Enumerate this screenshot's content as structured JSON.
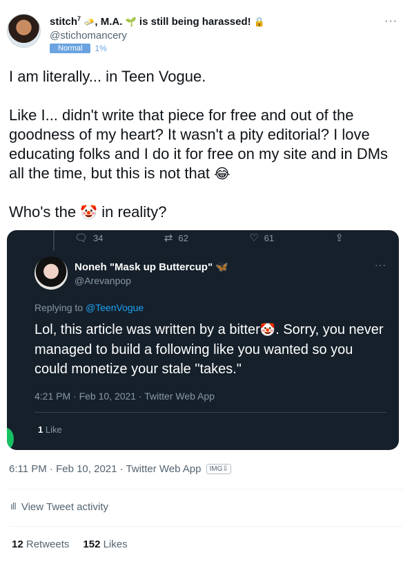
{
  "author": {
    "name_start": "stitch",
    "name_sup": "7",
    "name_emoji_1": "🧈",
    "name_degree": ", M.A.",
    "name_emoji_2": "🌱",
    "name_end": " is still being harassed!",
    "name_emoji_3": "🔒",
    "handle": "@stichomancery",
    "badge": "Normal",
    "badge_pct": "1%"
  },
  "more_icon": "···",
  "tweet": {
    "line1": "I am literally... in Teen Vogue.",
    "line2": "Like I... didn't write that piece for free and out of the goodness of my heart? It wasn't a pity editorial? I love educating folks and I do it for free on my site and in DMs all the time, but this is not that",
    "line2_emoji": "😂",
    "line3_start": "Who's the",
    "line3_emoji": "🤡",
    "line3_end": "in reality?"
  },
  "embed": {
    "actions": {
      "reply_icon": "reply-icon",
      "reply_count": "34",
      "retweet_count": "62",
      "like_count": "61"
    },
    "author_name": "Noneh \"Mask up Buttercup\"",
    "author_emoji": "🦋",
    "author_handle": "@Arevanpop",
    "replying_prefix": "Replying to",
    "replying_mention": "@TeenVogue",
    "text_start": "Lol, this article was written by a bitter",
    "text_emoji": "🤡",
    "text_end": ". Sorry, you never managed to build a following like you wanted so you could monetize your stale \"takes.\"",
    "meta": "4:21 PM · Feb 10, 2021 · Twitter Web App",
    "likes_count": "1",
    "likes_label": "Like"
  },
  "meta": {
    "timestamp": "6:11 PM · Feb 10, 2021 · Twitter Web App",
    "img_tag": "IMG⇩"
  },
  "activity": {
    "label": "View Tweet activity"
  },
  "stats": {
    "retweets_count": "12",
    "retweets_label": "Retweets",
    "likes_count": "152",
    "likes_label": "Likes"
  }
}
